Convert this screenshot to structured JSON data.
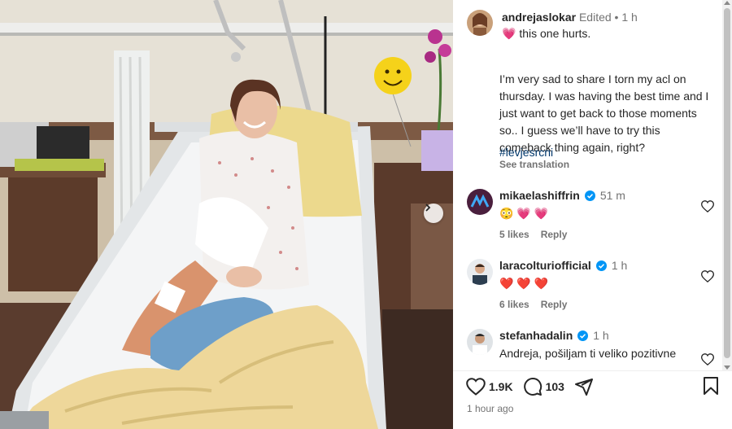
{
  "post": {
    "author": "andrejaslokar",
    "edited_label": "Edited",
    "separator": "•",
    "timestamp": "1 h",
    "caption_first": "this one hurts.",
    "caption_body": "I’m very sad to share I torn my acl on thursday. I was having the best time and I just want to get back to those moments so.. I guess we’ll have to try this comeback thing again, right?",
    "hashtag": "#levjesrcni",
    "see_translation": "See translation",
    "first_emoji": "💗"
  },
  "comments": [
    {
      "username": "mikaelashiffrin",
      "time": "51 m",
      "content": "😳 💗 💗",
      "likes": "5 likes",
      "reply": "Reply"
    },
    {
      "username": "laracolturiofficial",
      "time": "1 h",
      "content": "❤️ ❤️ ❤️",
      "likes": "6 likes",
      "reply": "Reply"
    },
    {
      "username": "stefanhadalin",
      "time": "1 h",
      "content": "Andreja, pošiljam ti veliko pozitivne"
    }
  ],
  "actions": {
    "likes_count": "1.9K",
    "comments_count": "103",
    "posted_ago": "1 hour ago"
  },
  "colors": {
    "verified": "#0095f6",
    "hashtag": "#00376b",
    "secondary_text": "#737373"
  },
  "icons": {
    "like": "heart-outline-icon",
    "comment": "speech-bubble-icon",
    "share": "paper-plane-icon",
    "save": "bookmark-icon",
    "carousel": "chevron-right-icon"
  }
}
